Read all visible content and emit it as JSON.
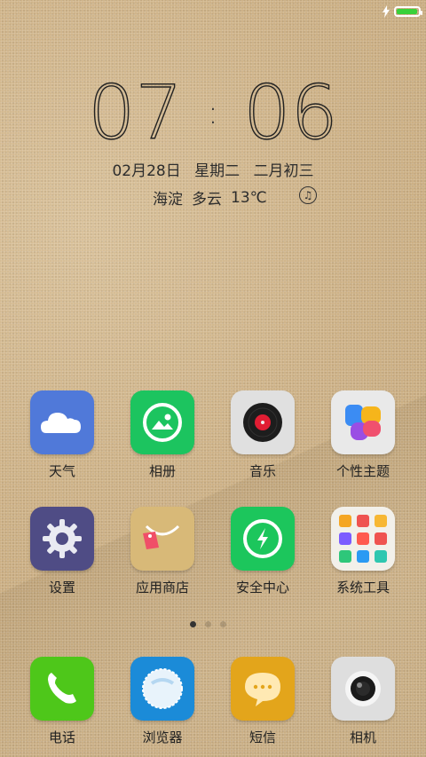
{
  "statusbar": {
    "battery_fill_fraction": 0.95,
    "charging": true,
    "battery_color": "#39d13a"
  },
  "clock": {
    "hour": "07",
    "minute": "06",
    "separator": ":"
  },
  "date": {
    "day": "02月28日",
    "weekday": "星期二",
    "lunar": "二月初三"
  },
  "weather": {
    "city": "海淀",
    "condition": "多云",
    "temp": "13℃"
  },
  "apps": [
    {
      "label": "天气",
      "icon": "cloud-icon",
      "color": "#4f78d8"
    },
    {
      "label": "相册",
      "icon": "gallery-icon",
      "color": "#1cc45f"
    },
    {
      "label": "音乐",
      "icon": "vinyl-record-icon",
      "color": "#dedede"
    },
    {
      "label": "个性主题",
      "icon": "theme-icon",
      "color": "#e8e8e8"
    },
    {
      "label": "设置",
      "icon": "gear-icon",
      "color": "#4f4c85"
    },
    {
      "label": "应用商店",
      "icon": "shopping-bag-icon",
      "color": "#d6b474"
    },
    {
      "label": "安全中心",
      "icon": "shield-bolt-icon",
      "color": "#1cc65c"
    },
    {
      "label": "系统工具",
      "icon": "folder-icon",
      "color": "#f2f0ea"
    }
  ],
  "dock": [
    {
      "label": "电话",
      "icon": "phone-icon",
      "color": "#4cc719"
    },
    {
      "label": "浏览器",
      "icon": "browser-icon",
      "color": "#1a86d5"
    },
    {
      "label": "短信",
      "icon": "message-icon",
      "color": "#e2a21a"
    },
    {
      "label": "相机",
      "icon": "camera-icon",
      "color": "#dcdcdc"
    }
  ],
  "pages": {
    "count": 3,
    "active": 1
  }
}
